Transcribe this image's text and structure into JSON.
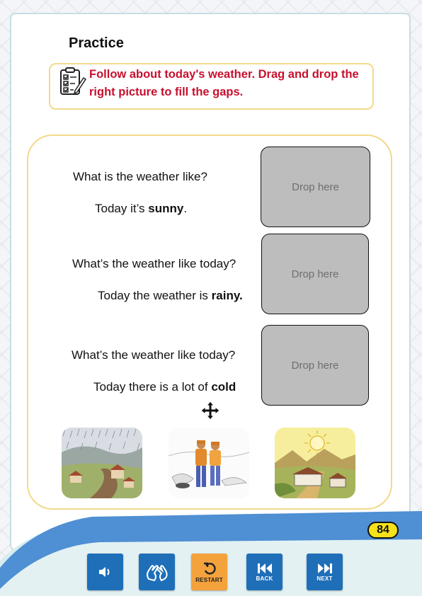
{
  "page": {
    "title": "Practice",
    "page_number": "84"
  },
  "instruction": {
    "text": "Follow about today's weather. Drag and drop the right picture to fill the gaps.",
    "icon": "clipboard-checklist-icon"
  },
  "items": [
    {
      "question": "What is the weather like?",
      "answer_prefix": "Today it’s ",
      "answer_bold": "sunny",
      "answer_suffix": ".",
      "drop_label": "Drop here"
    },
    {
      "question": "What’s the weather like today?",
      "answer_prefix": "Today the weather is ",
      "answer_bold": "rainy.",
      "answer_suffix": "",
      "drop_label": "Drop here"
    },
    {
      "question": "What’s the weather like today?",
      "answer_prefix": "Today there is a lot of ",
      "answer_bold": "cold",
      "answer_suffix": "",
      "drop_label": "Drop here"
    }
  ],
  "pictures": [
    {
      "name": "rainy-landscape-picture"
    },
    {
      "name": "cold-people-picture"
    },
    {
      "name": "sunny-village-picture"
    }
  ],
  "toolbar": {
    "audio_icon": "speaker-icon",
    "sign_icon": "sign-language-icon",
    "restart_label": "RESTART",
    "back_label": "BACK",
    "next_label": "NEXT"
  },
  "colors": {
    "instruction_text": "#c8102e",
    "accent_blue": "#1f6fb8",
    "restart_orange": "#f4a23c",
    "border_yellow": "#f3d98a",
    "page_badge": "#f6e21a"
  }
}
